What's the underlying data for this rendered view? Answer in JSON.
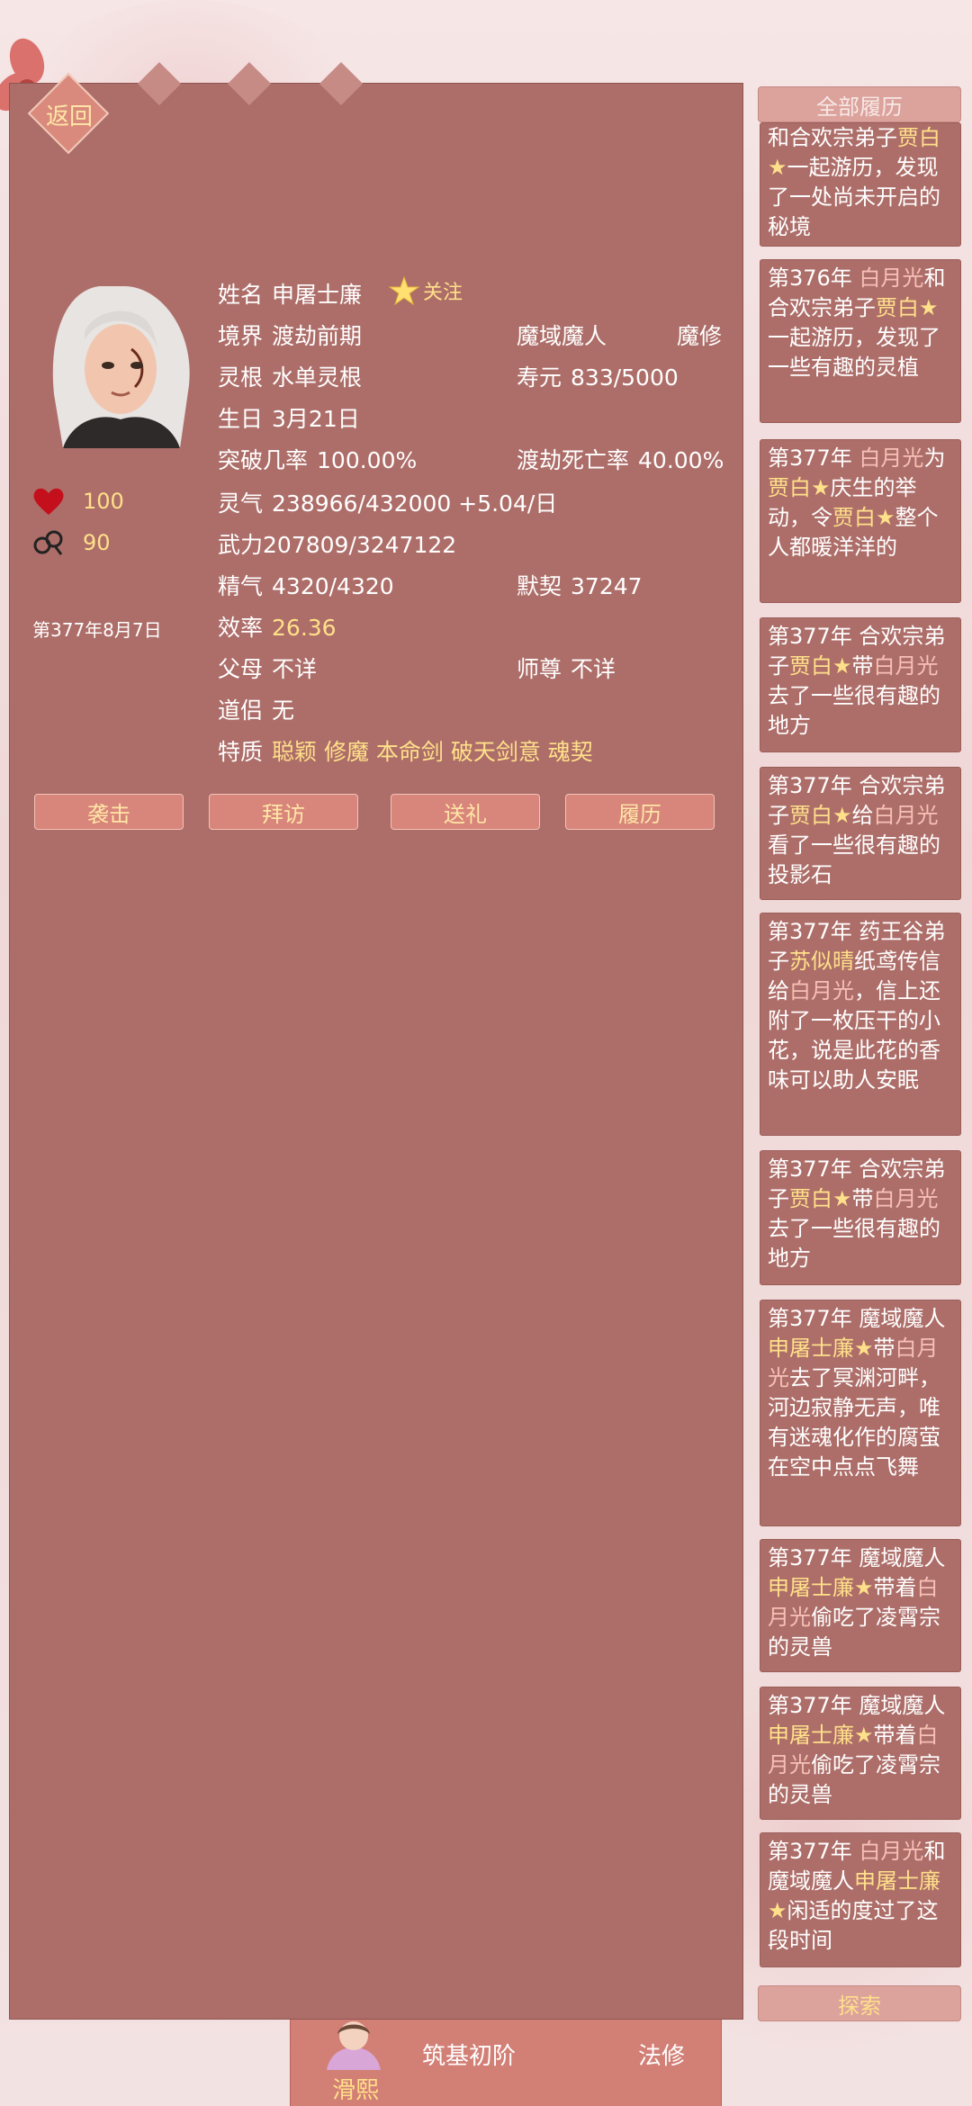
{
  "nav": {
    "back_label": "返回"
  },
  "character": {
    "name_label": "姓名",
    "name": "申屠士廉",
    "follow_label": "关注",
    "realm_label": "境界",
    "realm": "渡劫前期",
    "faction": "魔域魔人",
    "cultivation_type": "魔修",
    "root_label": "灵根",
    "root": "水单灵根",
    "lifespan_label": "寿元",
    "lifespan": "833/5000",
    "birthday_label": "生日",
    "birthday": "3月21日",
    "breakthrough_label": "突破几率",
    "breakthrough": "100.00%",
    "tribulation_label": "渡劫死亡率",
    "tribulation": "40.00%",
    "qi_label": "灵气",
    "qi": "238966/432000 +5.04/日",
    "power_label": "武力",
    "power": "207809/3247122",
    "essence_label": "精气",
    "essence": "4320/4320",
    "rapport_label": "默契",
    "rapport": "37247",
    "efficiency_label": "效率",
    "efficiency": "26.36",
    "parents_label": "父母",
    "parents": "不详",
    "master_label": "师尊",
    "master": "不详",
    "partner_label": "道侣",
    "partner": "无",
    "traits_label": "特质",
    "traits": "聪颖 修魔 本命剑 破天剑意 魂契",
    "favor": "100",
    "relation": "90",
    "date": "第377年8月7日"
  },
  "actions": [
    "袭击",
    "拜访",
    "送礼",
    "履历"
  ],
  "history": {
    "header": "全部履历",
    "entries": [
      [
        {
          "t": "和合欢宗弟子"
        },
        {
          "t": "贾白★",
          "c": "y"
        },
        {
          "t": "一起游历，发现了一处尚未开启的秘境"
        }
      ],
      [
        {
          "t": "第376年 "
        },
        {
          "t": "白月光",
          "c": "p"
        },
        {
          "t": "和合欢宗弟子"
        },
        {
          "t": "贾白★",
          "c": "y"
        },
        {
          "t": "一起游历，发现了一些有趣的灵植"
        }
      ],
      [
        {
          "t": "第377年 "
        },
        {
          "t": "白月光",
          "c": "p"
        },
        {
          "t": "为"
        },
        {
          "t": "贾白★",
          "c": "y"
        },
        {
          "t": "庆生的举动，令"
        },
        {
          "t": "贾白★",
          "c": "y"
        },
        {
          "t": "整个人都暖洋洋的"
        }
      ],
      [
        {
          "t": "第377年 合欢宗弟子"
        },
        {
          "t": "贾白★",
          "c": "y"
        },
        {
          "t": "带"
        },
        {
          "t": "白月光",
          "c": "p"
        },
        {
          "t": "去了一些很有趣的地方"
        }
      ],
      [
        {
          "t": "第377年 合欢宗弟子"
        },
        {
          "t": "贾白★",
          "c": "y"
        },
        {
          "t": "给"
        },
        {
          "t": "白月光",
          "c": "p"
        },
        {
          "t": "看了一些很有趣的投影石"
        }
      ],
      [
        {
          "t": "第377年 药王谷弟子"
        },
        {
          "t": "苏似晴",
          "c": "y"
        },
        {
          "t": "纸鸢传信给"
        },
        {
          "t": "白月光",
          "c": "p"
        },
        {
          "t": "，信上还附了一枚压干的小花，说是此花的香味可以助人安眠"
        }
      ],
      [
        {
          "t": "第377年 合欢宗弟子"
        },
        {
          "t": "贾白★",
          "c": "y"
        },
        {
          "t": "带"
        },
        {
          "t": "白月光",
          "c": "p"
        },
        {
          "t": "去了一些很有趣的地方"
        }
      ],
      [
        {
          "t": "第377年 魔域魔人"
        },
        {
          "t": "申屠士廉★",
          "c": "y"
        },
        {
          "t": "带"
        },
        {
          "t": "白月光",
          "c": "p"
        },
        {
          "t": "去了冥渊河畔，河边寂静无声，唯有迷魂化作的腐萤在空中点点飞舞"
        }
      ],
      [
        {
          "t": "第377年 魔域魔人"
        },
        {
          "t": "申屠士廉★",
          "c": "y"
        },
        {
          "t": "带着"
        },
        {
          "t": "白月光",
          "c": "p"
        },
        {
          "t": "偷吃了凌霄宗的灵兽"
        }
      ],
      [
        {
          "t": "第377年 魔域魔人"
        },
        {
          "t": "申屠士廉★",
          "c": "y"
        },
        {
          "t": "带着"
        },
        {
          "t": "白月光",
          "c": "p"
        },
        {
          "t": "偷吃了凌霄宗的灵兽"
        }
      ],
      [
        {
          "t": "第377年 "
        },
        {
          "t": "白月光",
          "c": "p"
        },
        {
          "t": "和魔域魔人"
        },
        {
          "t": "申屠士廉★",
          "c": "y"
        },
        {
          "t": "闲适的度过了这段时间"
        }
      ]
    ],
    "explore_label": "探索"
  },
  "bottom": {
    "name": "滑熙",
    "realm": "筑基初阶",
    "cultivation_type": "法修"
  },
  "colors": {
    "panel": "#ad6e69",
    "accent_yellow": "#ffe08a",
    "accent_pink": "#f7c0b6",
    "button": "#d8857b"
  }
}
